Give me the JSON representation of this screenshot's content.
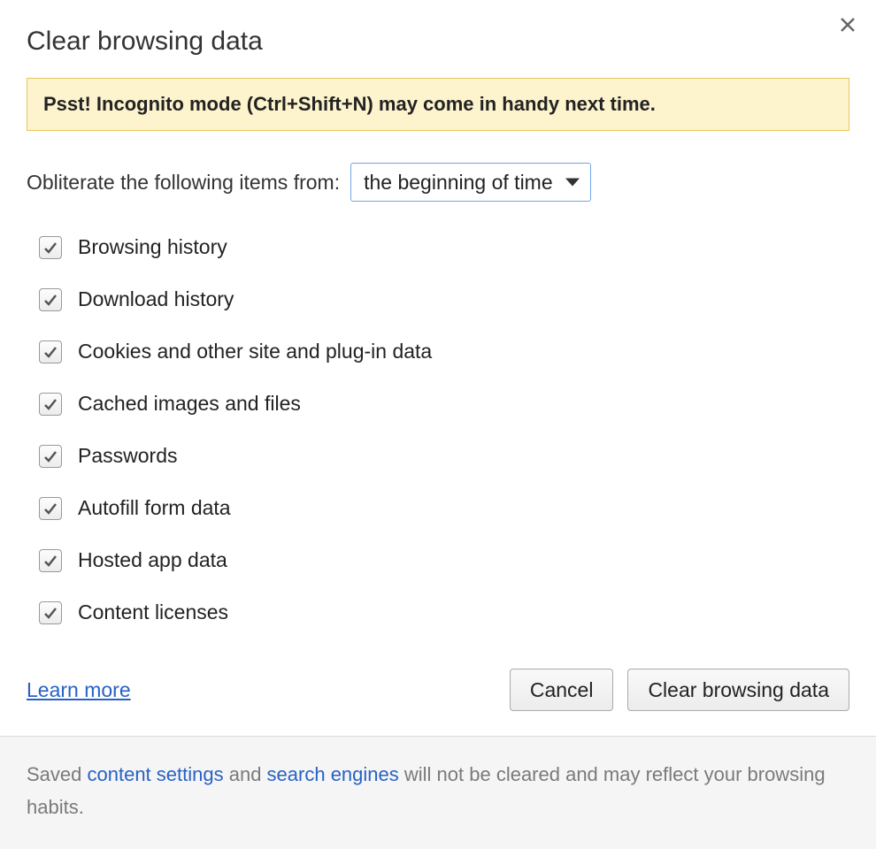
{
  "dialog": {
    "title": "Clear browsing data",
    "tip": "Psst! Incognito mode (Ctrl+Shift+N) may come in handy next time.",
    "obliterate_label": "Obliterate the following items from:",
    "time_range_selected": "the beginning of time",
    "items": [
      {
        "label": "Browsing history",
        "checked": true
      },
      {
        "label": "Download history",
        "checked": true
      },
      {
        "label": "Cookies and other site and plug-in data",
        "checked": true
      },
      {
        "label": "Cached images and files",
        "checked": true
      },
      {
        "label": "Passwords",
        "checked": true
      },
      {
        "label": "Autofill form data",
        "checked": true
      },
      {
        "label": "Hosted app data",
        "checked": true
      },
      {
        "label": "Content licenses",
        "checked": true
      }
    ],
    "learn_more": "Learn more",
    "cancel": "Cancel",
    "clear": "Clear browsing data"
  },
  "footer": {
    "pre": "Saved ",
    "link1": "content settings",
    "mid": " and ",
    "link2": "search engines",
    "post": " will not be cleared and may reflect your browsing habits."
  }
}
